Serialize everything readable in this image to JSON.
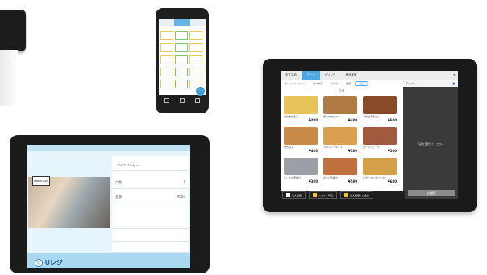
{
  "phone": {
    "tabs": [
      "",
      "",
      ""
    ],
    "cells": [
      "",
      "",
      "",
      "",
      "",
      "",
      "",
      "",
      "",
      "",
      "",
      "",
      "",
      "",
      ""
    ]
  },
  "left_tablet": {
    "rows": [
      {
        "label": "アイスコーヒー",
        "value": ""
      },
      {
        "label": "点数",
        "value": "1"
      },
      {
        "label": "金額",
        "value": "¥500"
      }
    ],
    "photo_sign": "URECH Cafe",
    "logo_text": "Uレジ"
  },
  "right_tablet": {
    "tabs": [
      "おすすめ",
      "フード",
      "ドリンク",
      "食品宝庫"
    ],
    "active_tab": 1,
    "subtabs": [
      "オリジナル フード",
      "揚げ物系",
      "サラダ",
      "麺類",
      "ご飯系"
    ],
    "pager": "1/2",
    "items": [
      {
        "name": "出汁巻き玉子",
        "price": "¥480",
        "color": "#e8c35a"
      },
      {
        "name": "鶏むね肉のカツ",
        "price": "¥480",
        "color": "#b07a45"
      },
      {
        "name": "牛筋土手煮込み",
        "price": "¥680",
        "color": "#8a4b2a"
      },
      {
        "name": "焼き餃子",
        "price": "¥480",
        "color": "#c98a4a"
      },
      {
        "name": "スパイシーポテト",
        "price": "¥380",
        "color": "#d9a04f"
      },
      {
        "name": "ローストビーフ",
        "price": "¥580",
        "color": "#a15a3e"
      },
      {
        "name": "ししゃも唐揚げ",
        "price": "¥380",
        "color": "#9aa0a6"
      },
      {
        "name": "ほっけの開き",
        "price": "¥580",
        "color": "#c0703f"
      },
      {
        "name": "ピザ・マルゲリータ",
        "price": "¥680",
        "color": "#d4a04a"
      }
    ],
    "side_header": "テーブル",
    "side_message": "商品を選択してください",
    "confirm_button": "注文確定",
    "bottom_buttons": [
      "注文履歴",
      "スタッフ呼出",
      "注文履歴 / お会計"
    ]
  }
}
